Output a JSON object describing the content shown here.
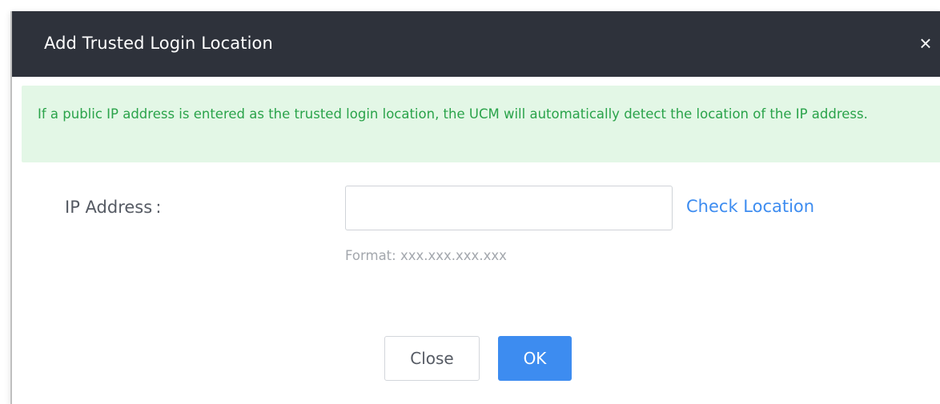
{
  "dialog": {
    "title": "Add Trusted Login Location",
    "close_glyph": "×",
    "close_icon": "close-icon"
  },
  "banner": {
    "text": "If a public IP address is entered as the trusted login location, the UCM will automatically detect the location of the IP address.",
    "color": "#2aa34a",
    "background": "#e3f7e6"
  },
  "form": {
    "ip_label": "IP Address :",
    "ip_value": "",
    "ip_placeholder": "",
    "check_location_label": "Check Location",
    "format_hint": "Format: xxx.xxx.xxx.xxx"
  },
  "buttons": {
    "close_label": "Close",
    "ok_label": "OK"
  },
  "colors": {
    "header": "#2e323b",
    "primary": "#3d8cf0"
  }
}
